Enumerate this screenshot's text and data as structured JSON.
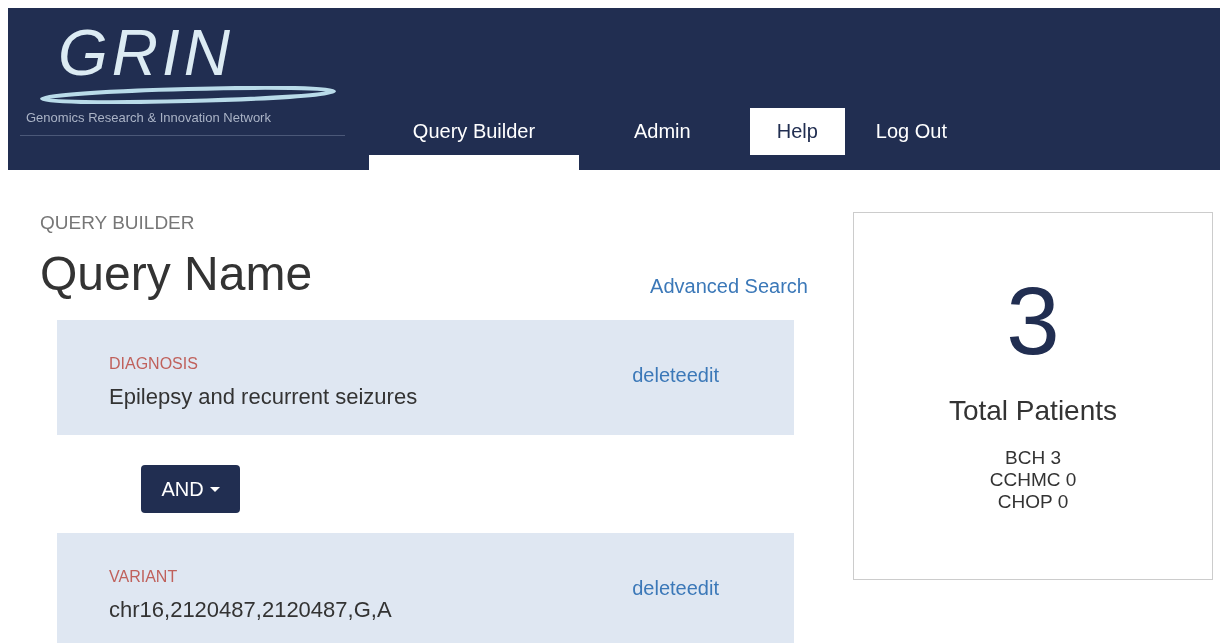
{
  "logo": {
    "title": "GRIN",
    "subtitle": "Genomics Research & Innovation Network"
  },
  "nav": [
    {
      "label": "Query Builder",
      "selected": true,
      "highlighted": false
    },
    {
      "label": "Admin",
      "selected": false,
      "highlighted": false
    },
    {
      "label": "Help",
      "selected": false,
      "highlighted": true
    },
    {
      "label": "Log Out",
      "selected": false,
      "highlighted": false
    }
  ],
  "section_label": "QUERY BUILDER",
  "query_name": "Query Name",
  "advanced_link": "Advanced Search",
  "criteria": [
    {
      "kind": "criterion",
      "category": "DIAGNOSIS",
      "value": "Epilepsy and recurrent seizures",
      "actions": "deleteedit"
    },
    {
      "kind": "operator",
      "label": "AND"
    },
    {
      "kind": "criterion",
      "category": "VARIANT",
      "value": "chr16,2120487,2120487,G,A",
      "actions": "deleteedit"
    }
  ],
  "summary": {
    "count": "3",
    "title": "Total Patients",
    "sites": [
      "BCH 3",
      "CCHMC 0",
      "CHOP 0"
    ]
  }
}
